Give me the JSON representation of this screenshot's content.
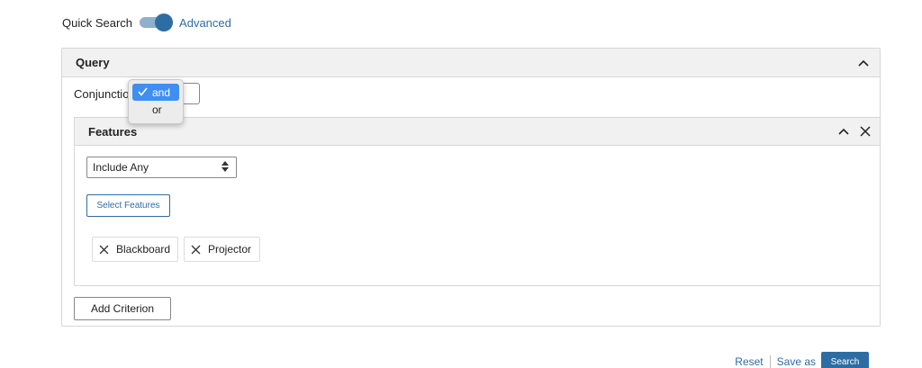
{
  "top": {
    "quick_search_label": "Quick Search",
    "advanced_label": "Advanced",
    "toggle_on": true
  },
  "query_panel": {
    "title": "Query",
    "conjunction_label": "Conjunction",
    "conjunction_options": [
      "and",
      "or"
    ],
    "conjunction_selected": "and"
  },
  "features_panel": {
    "title": "Features",
    "include_select_value": "Include Any",
    "select_features_label": "Select Features",
    "chips": [
      "Blackboard",
      "Projector"
    ]
  },
  "add_criterion_label": "Add Criterion",
  "actions": {
    "reset_label": "Reset",
    "save_as_label": "Save as",
    "search_label": "Search"
  },
  "colors": {
    "accent": "#2e6da4",
    "toggle_track": "#8fb0cc",
    "dropdown_highlight": "#3f8ff2"
  }
}
